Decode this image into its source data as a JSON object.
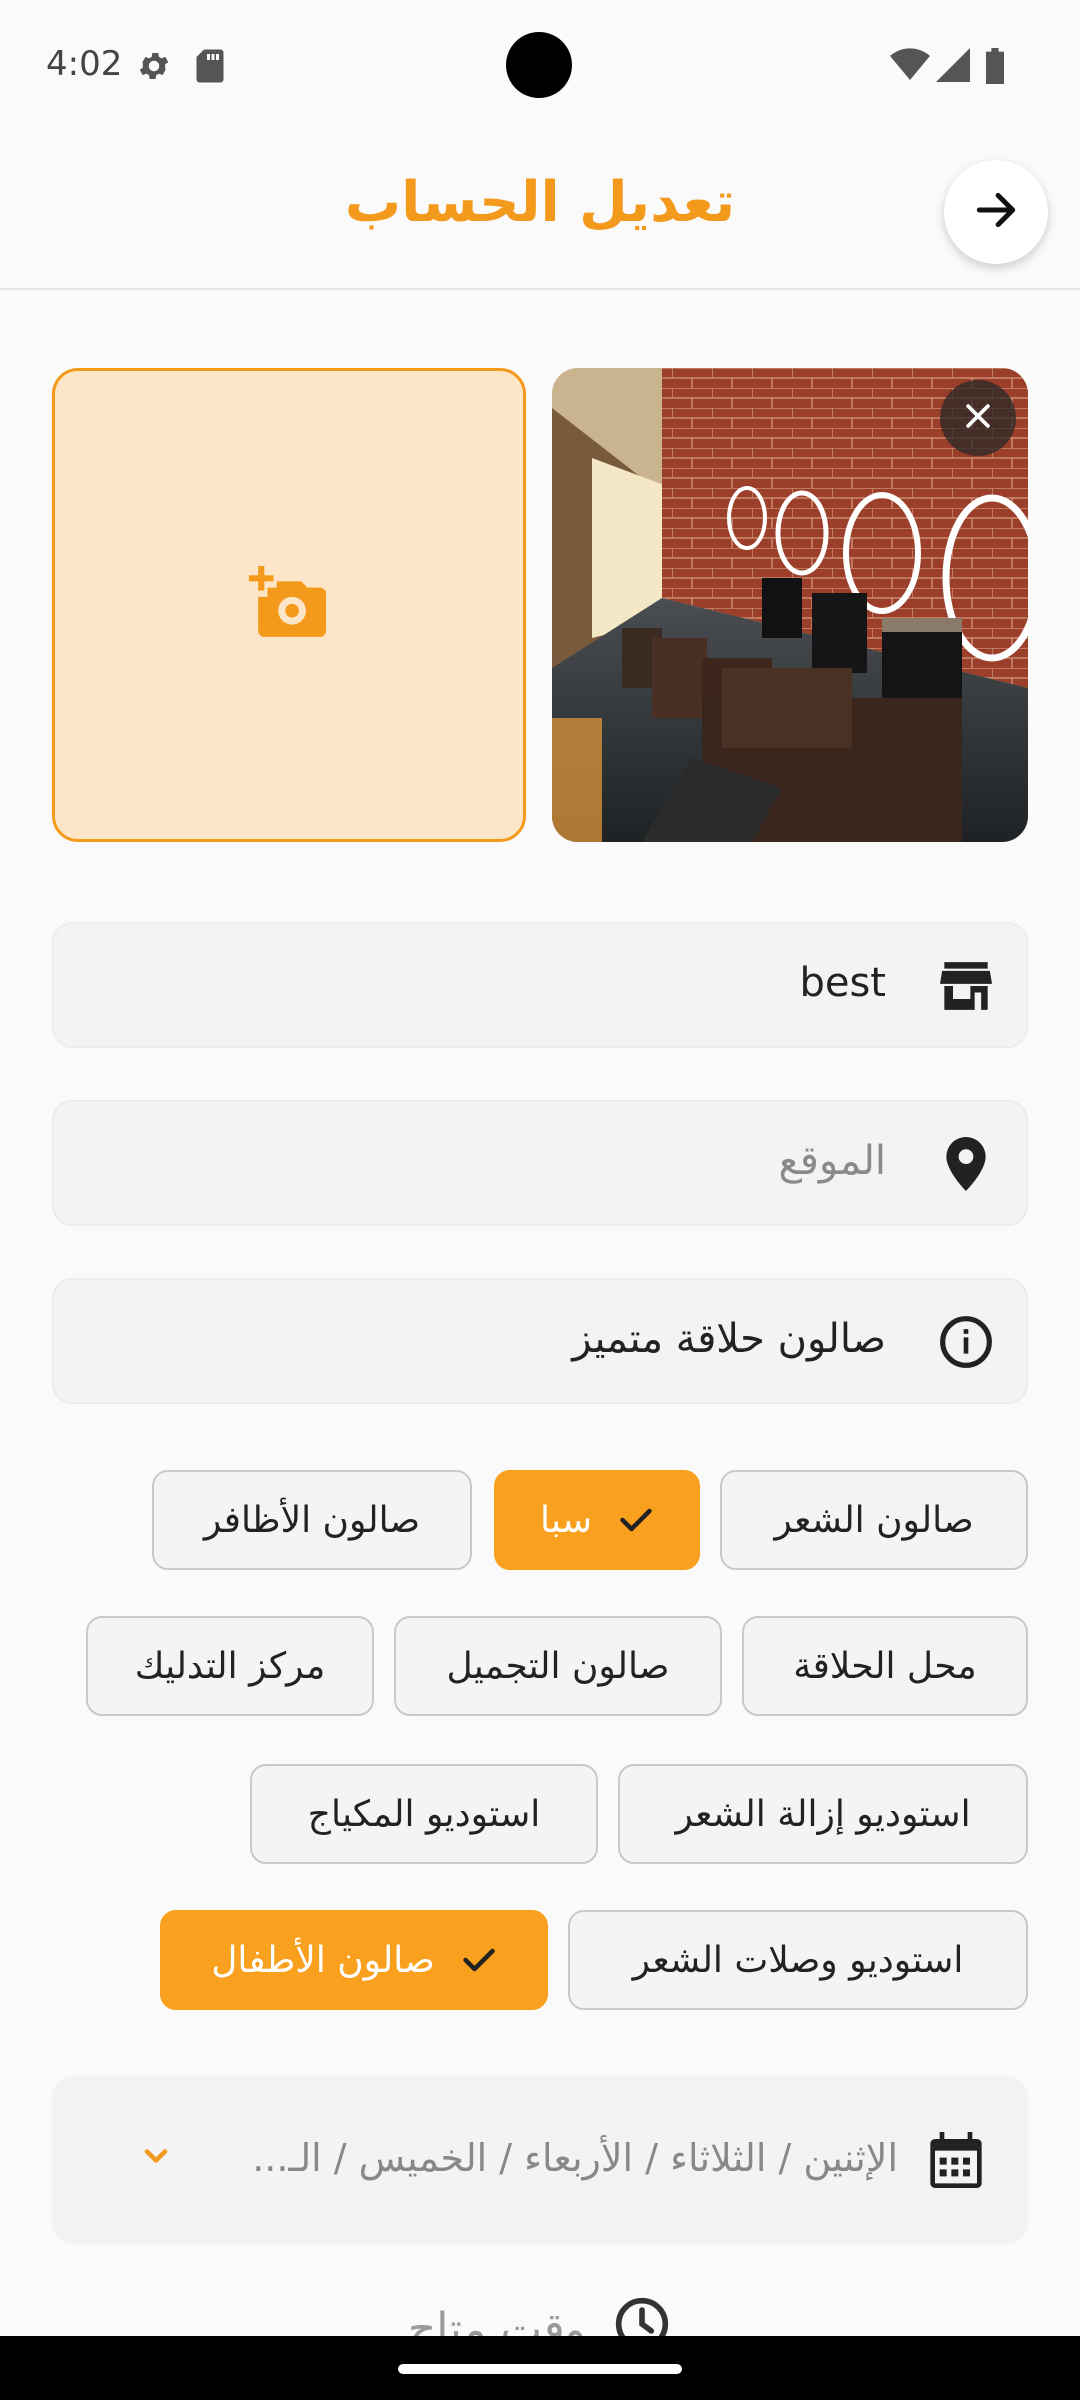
{
  "status_bar": {
    "time": "4:02"
  },
  "header": {
    "title": "تعديل الحساب"
  },
  "photos": {},
  "fields": {
    "name_value": "best",
    "location_placeholder": "الموقع",
    "description_value": "صالون حلاقة متميز"
  },
  "categories": [
    {
      "label": "صالون الشعر",
      "selected": false
    },
    {
      "label": "سبا",
      "selected": true
    },
    {
      "label": "صالون الأظافر",
      "selected": false
    },
    {
      "label": "محل الحلاقة",
      "selected": false
    },
    {
      "label": "صالون التجميل",
      "selected": false
    },
    {
      "label": "مركز التدليك",
      "selected": false
    },
    {
      "label": "استوديو إزالة الشعر",
      "selected": false
    },
    {
      "label": "استوديو المكياج",
      "selected": false
    },
    {
      "label": "استوديو وصلات الشعر",
      "selected": false
    },
    {
      "label": "صالون الأطفال",
      "selected": true
    }
  ],
  "schedule": {
    "days_value": "الإثنين / الثلاثاء / الأربعاء / الخميس / الـ...",
    "time_label": "وقت متاح"
  },
  "colors": {
    "accent": "#f9a01e",
    "title": "#f39a1c"
  }
}
